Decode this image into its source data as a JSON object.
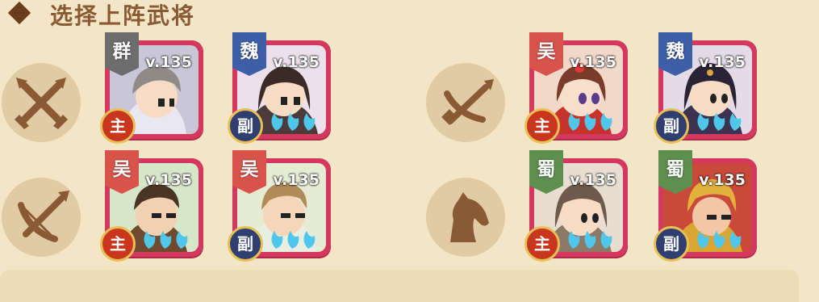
{
  "header": {
    "title": "选择上阵武将"
  },
  "classes": [
    {
      "name": "halberd",
      "icon": "crossed-halberds-icon"
    },
    {
      "name": "crossbow",
      "icon": "crossbow-icon"
    },
    {
      "name": "bow",
      "icon": "bow-icon"
    },
    {
      "name": "cavalry",
      "icon": "horse-icon"
    }
  ],
  "generals": [
    {
      "faction": "群",
      "level": "v.135",
      "role": "主",
      "faction_color": "#6d6d6d"
    },
    {
      "faction": "魏",
      "level": "v.135",
      "role": "副",
      "faction_color": "#3e5fa8"
    },
    {
      "faction": "吴",
      "level": "v.135",
      "role": "主",
      "faction_color": "#d8534a"
    },
    {
      "faction": "魏",
      "level": "v.135",
      "role": "副",
      "faction_color": "#3e5fa8"
    },
    {
      "faction": "吴",
      "level": "v.135",
      "role": "主",
      "faction_color": "#d8534a"
    },
    {
      "faction": "吴",
      "level": "v.135",
      "role": "副",
      "faction_color": "#d8534a"
    },
    {
      "faction": "蜀",
      "level": "v.135",
      "role": "主",
      "faction_color": "#5e8f4e"
    },
    {
      "faction": "蜀",
      "level": "v.135",
      "role": "副",
      "faction_color": "#5e8f4e"
    }
  ],
  "colors": {
    "background": "#f3e6c6",
    "card_border": "#d4385e",
    "role_main": "#c8361d",
    "role_sub": "#2f3f70",
    "icon_bg": "#e1cba5",
    "icon_fg": "#8a5a35"
  }
}
